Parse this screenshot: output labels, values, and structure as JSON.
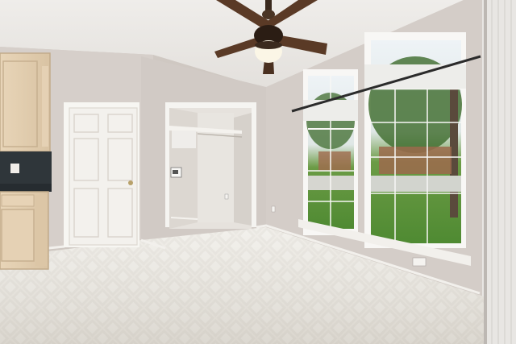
{
  "scene": {
    "kind": "photo",
    "subject": "empty-room-interior",
    "colors": {
      "ceiling": "#ece9e6",
      "walls": "#d2cbc6",
      "floor_tile": "#e9e7e0",
      "cabinets": "#e2cdb0",
      "door": "#f4f2ee",
      "fan_blades": "#5a3a26",
      "window_frame": "#f7f6f3",
      "lawn": "#5f9a3e",
      "sky": "#eef3f6",
      "backsplash": "#2f363a"
    }
  }
}
